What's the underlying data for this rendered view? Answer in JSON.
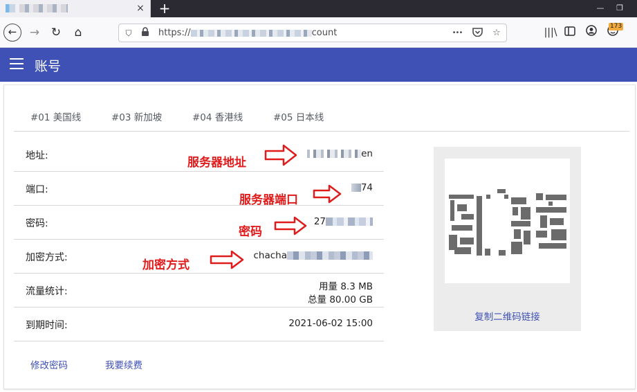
{
  "browser": {
    "tab_close": "×",
    "new_tab": "+",
    "url_prefix": "https://",
    "url_suffix": "count",
    "url_more": "•••",
    "badge_count": "173"
  },
  "appbar": {
    "title": "账号"
  },
  "server_tabs": [
    "#01 美国线",
    "#03 新加坡",
    "#04 香港线",
    "#05 日本线"
  ],
  "fields": {
    "address": {
      "label": "地址:",
      "value_end": "en"
    },
    "port": {
      "label": "端口:",
      "value_end": "74"
    },
    "password": {
      "label": "密码:",
      "value_start": "27"
    },
    "encryption": {
      "label": "加密方式:",
      "value_start": "chacha"
    },
    "traffic": {
      "label": "流量统计:",
      "used": "用量 8.3 MB",
      "total": "总量 80.00 GB"
    },
    "expiry": {
      "label": "到期时间:",
      "value": "2021-06-02 15:00"
    }
  },
  "actions": {
    "change_password": "修改密码",
    "renew": "我要续费"
  },
  "qr": {
    "copy_link": "复制二维码链接"
  },
  "annotations": {
    "server_address": "服务器地址",
    "server_port": "服务器端口",
    "password": "密码",
    "encryption": "加密方式"
  },
  "colors": {
    "primary": "#3f51b5",
    "annotation": "#e01b1b",
    "tab_strip": "#2b2a33"
  }
}
